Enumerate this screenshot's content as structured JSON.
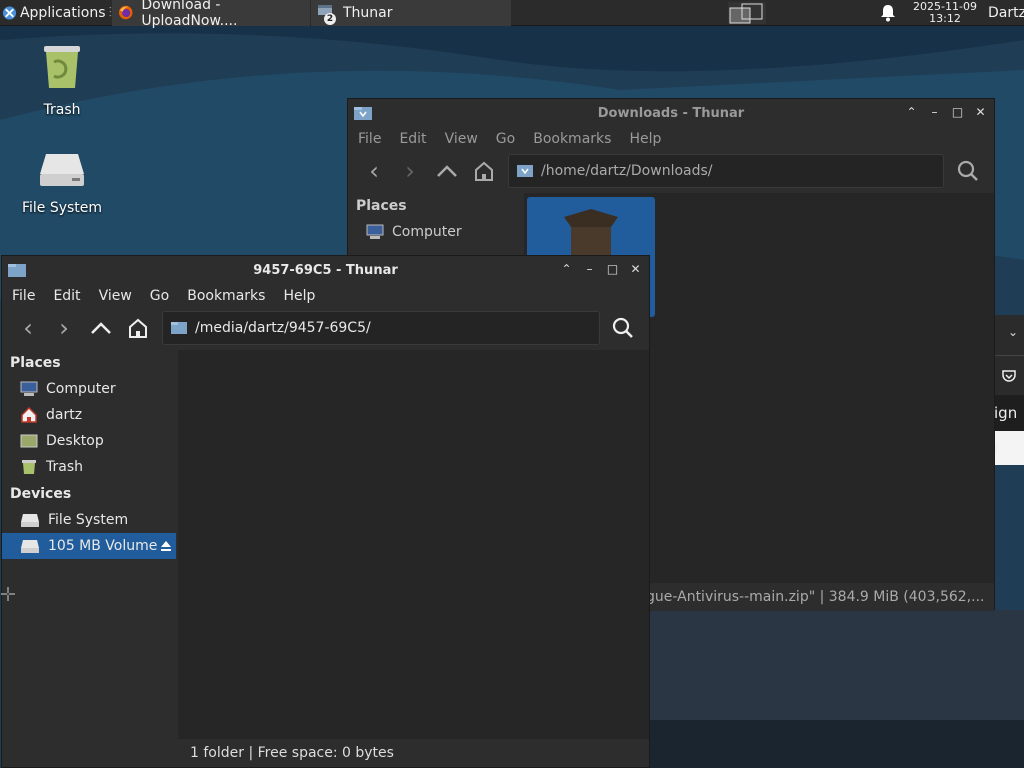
{
  "panel": {
    "applications": "Applications",
    "tasks": [
      {
        "label": "Download - UploadNow...."
      },
      {
        "label": "Thunar",
        "badge": "2"
      }
    ],
    "clock_date": "2025-11-09",
    "clock_time": "13:12",
    "user": "Dartz"
  },
  "desktop": {
    "icons": [
      {
        "label": "Trash"
      },
      {
        "label": "File System"
      }
    ]
  },
  "win_back": {
    "title": "Downloads - Thunar",
    "menu": [
      "File",
      "Edit",
      "View",
      "Go",
      "Bookmarks",
      "Help"
    ],
    "path": "/home/dartz/Downloads/",
    "places_header": "Places",
    "places": [
      {
        "label": "Computer"
      }
    ],
    "status": "gue-Antivirus--main.zip\"  |  384.9 MiB (403,562,..."
  },
  "win_front": {
    "title": "9457-69C5 - Thunar",
    "menu": [
      "File",
      "Edit",
      "View",
      "Go",
      "Bookmarks",
      "Help"
    ],
    "path": "/media/dartz/9457-69C5/",
    "places_header": "Places",
    "places": [
      {
        "label": "Computer"
      },
      {
        "label": "dartz"
      },
      {
        "label": "Desktop"
      },
      {
        "label": "Trash"
      }
    ],
    "devices_header": "Devices",
    "devices": [
      {
        "label": "File System"
      },
      {
        "label": "105 MB Volume"
      }
    ],
    "status": "1 folder  |  Free space: 0 bytes"
  },
  "browser_peek": {
    "text": "ign i"
  },
  "colors": {
    "selection": "#215d9c",
    "panel": "#2b2b2b",
    "window": "#2d2d2d"
  }
}
